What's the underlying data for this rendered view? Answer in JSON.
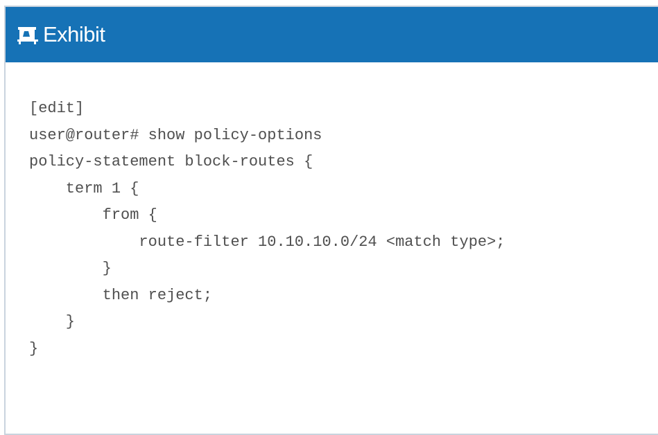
{
  "header": {
    "icon": "exhibit-icon",
    "title": "Exhibit",
    "background_color": "#1672b6"
  },
  "code": {
    "lines": [
      "[edit]",
      "user@router# show policy-options",
      "policy-statement block-routes {",
      "    term 1 {",
      "        from {",
      "            route-filter 10.10.10.0/24 <match type>;",
      "        }",
      "        then reject;",
      "    }",
      "}"
    ]
  }
}
